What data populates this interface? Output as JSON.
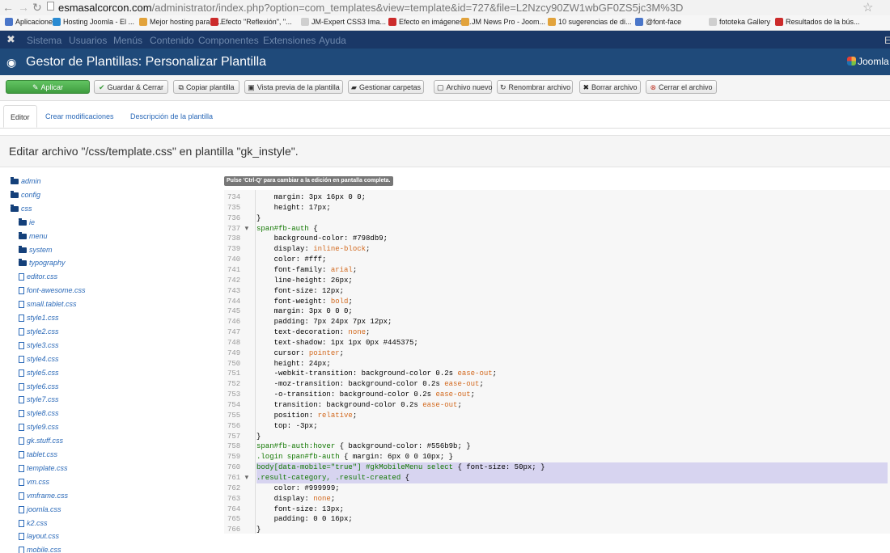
{
  "browser": {
    "url_host": "esmasalcorcon.com",
    "url_path": "/administrator/index.php?option=com_templates&view=template&id=727&file=L2Nzcy90ZW1wbGF0ZS5jc3M%3D",
    "bookmarks": [
      {
        "label": "Aplicaciones",
        "color": "#4a76c9"
      },
      {
        "label": "Hosting Joomla - El ...",
        "color": "#2a8bd2"
      },
      {
        "label": "Mejor hosting para J...",
        "color": "#e2a33c"
      },
      {
        "label": "Efecto \"Reflexión\", \"...",
        "color": "#cc2b2b"
      },
      {
        "label": "JM-Expert CSS3 Ima...",
        "color": "#cfcfcf"
      },
      {
        "label": "Efecto en imágenes ...",
        "color": "#cc2b2b"
      },
      {
        "label": "JM News Pro - Joom...",
        "color": "#e2a33c"
      },
      {
        "label": "10 sugerencias de di...",
        "color": "#e2a33c"
      },
      {
        "label": "@font-face",
        "color": "#4a76c9"
      },
      {
        "label": "fototeka Gallery",
        "color": "#cfcfcf"
      },
      {
        "label": "Resultados de la bús...",
        "color": "#cc2b2b"
      }
    ]
  },
  "admin_menu": [
    "Sistema",
    "Usuarios",
    "Menús",
    "Contenido",
    "Componentes",
    "Extensiones",
    "Ayuda"
  ],
  "admin_menu_right": "E",
  "header": {
    "title": "Gestor de Plantillas: Personalizar Plantilla",
    "logo_text": "Joomla"
  },
  "toolbar": [
    {
      "label": "Aplicar",
      "icon": "✎"
    },
    {
      "label": "Guardar & Cerrar",
      "icon": "✔"
    },
    {
      "label": "Copiar plantilla",
      "icon": "⧉"
    },
    {
      "label": "Vista previa de la plantilla",
      "icon": "▣"
    },
    {
      "label": "Gestionar carpetas",
      "icon": "▰"
    },
    {
      "label": "Archivo nuevo",
      "icon": "▢"
    },
    {
      "label": "Renombrar archivo",
      "icon": "↻"
    },
    {
      "label": "Borrar archivo",
      "icon": "✖"
    },
    {
      "label": "Cerrar el archivo",
      "icon": "⊗"
    }
  ],
  "tabs": [
    "Editor",
    "Crear modificaciones",
    "Descripción de la plantilla"
  ],
  "edit_title": "Editar archivo \"/css/template.css\" en plantilla \"gk_instyle\".",
  "hint": "Pulse 'Ctrl-Q' para cambiar a la edición en pantalla completa.",
  "tree": [
    {
      "label": "admin",
      "type": "folder",
      "depth": 0
    },
    {
      "label": "config",
      "type": "folder",
      "depth": 0
    },
    {
      "label": "css",
      "type": "folder",
      "depth": 0
    },
    {
      "label": "ie",
      "type": "folder",
      "depth": 1
    },
    {
      "label": "menu",
      "type": "folder",
      "depth": 1
    },
    {
      "label": "system",
      "type": "folder",
      "depth": 1
    },
    {
      "label": "typography",
      "type": "folder",
      "depth": 1
    },
    {
      "label": "editor.css",
      "type": "file",
      "depth": 1
    },
    {
      "label": "font-awesome.css",
      "type": "file",
      "depth": 1
    },
    {
      "label": "small.tablet.css",
      "type": "file",
      "depth": 1
    },
    {
      "label": "style1.css",
      "type": "file",
      "depth": 1
    },
    {
      "label": "style2.css",
      "type": "file",
      "depth": 1
    },
    {
      "label": "style3.css",
      "type": "file",
      "depth": 1
    },
    {
      "label": "style4.css",
      "type": "file",
      "depth": 1
    },
    {
      "label": "style5.css",
      "type": "file",
      "depth": 1
    },
    {
      "label": "style6.css",
      "type": "file",
      "depth": 1
    },
    {
      "label": "style7.css",
      "type": "file",
      "depth": 1
    },
    {
      "label": "style8.css",
      "type": "file",
      "depth": 1
    },
    {
      "label": "style9.css",
      "type": "file",
      "depth": 1
    },
    {
      "label": "gk.stuff.css",
      "type": "file",
      "depth": 1
    },
    {
      "label": "tablet.css",
      "type": "file",
      "depth": 1
    },
    {
      "label": "template.css",
      "type": "file",
      "depth": 1
    },
    {
      "label": "vm.css",
      "type": "file",
      "depth": 1
    },
    {
      "label": "vmframe.css",
      "type": "file",
      "depth": 1
    },
    {
      "label": "joomla.css",
      "type": "file",
      "depth": 1
    },
    {
      "label": "k2.css",
      "type": "file",
      "depth": 1
    },
    {
      "label": "layout.css",
      "type": "file",
      "depth": 1
    },
    {
      "label": "mobile.css",
      "type": "file",
      "depth": 1
    }
  ],
  "code": [
    {
      "n": "734",
      "text": "    margin: 3px 16px 0 0;"
    },
    {
      "n": "735",
      "text": "    height: 17px;"
    },
    {
      "n": "736",
      "text": "}"
    },
    {
      "n": "737",
      "fold": true,
      "text": "span#fb-auth {"
    },
    {
      "n": "738",
      "text": "    background-color: #798db9;"
    },
    {
      "n": "739",
      "text": "    display: inline-block;"
    },
    {
      "n": "740",
      "text": "    color: #fff;"
    },
    {
      "n": "741",
      "text": "    font-family: arial;"
    },
    {
      "n": "742",
      "text": "    line-height: 26px;"
    },
    {
      "n": "743",
      "text": "    font-size: 12px;"
    },
    {
      "n": "744",
      "text": "    font-weight: bold;"
    },
    {
      "n": "745",
      "text": "    margin: 3px 0 0 0;"
    },
    {
      "n": "746",
      "text": "    padding: 7px 24px 7px 12px;"
    },
    {
      "n": "747",
      "text": "    text-decoration: none;"
    },
    {
      "n": "748",
      "text": "    text-shadow: 1px 1px 0px #445375;"
    },
    {
      "n": "749",
      "text": "    cursor: pointer;"
    },
    {
      "n": "750",
      "text": "    height: 24px;"
    },
    {
      "n": "751",
      "text": "    -webkit-transition: background-color 0.2s ease-out;"
    },
    {
      "n": "752",
      "text": "    -moz-transition: background-color 0.2s ease-out;"
    },
    {
      "n": "753",
      "text": "    -o-transition: background-color 0.2s ease-out;"
    },
    {
      "n": "754",
      "text": "    transition: background-color 0.2s ease-out;"
    },
    {
      "n": "755",
      "text": "    position: relative;"
    },
    {
      "n": "756",
      "text": "    top: -3px;"
    },
    {
      "n": "757",
      "text": "}"
    },
    {
      "n": "758",
      "text": "span#fb-auth:hover { background-color: #556b9b; }"
    },
    {
      "n": "759",
      "text": ".login span#fb-auth { margin: 6px 0 0 10px; }"
    },
    {
      "n": "760",
      "highlight": true,
      "text": "body[data-mobile=\"true\"] #gkMobileMenu select { font-size: 50px; }"
    },
    {
      "n": "761",
      "fold": true,
      "highlight": true,
      "text": ".result-category, .result-created {"
    },
    {
      "n": "762",
      "text": "    color: #999999;"
    },
    {
      "n": "763",
      "text": "    display: none;"
    },
    {
      "n": "764",
      "text": "    font-size: 13px;"
    },
    {
      "n": "765",
      "text": "    padding: 0 0 16px;"
    },
    {
      "n": "766",
      "text": "}"
    }
  ]
}
